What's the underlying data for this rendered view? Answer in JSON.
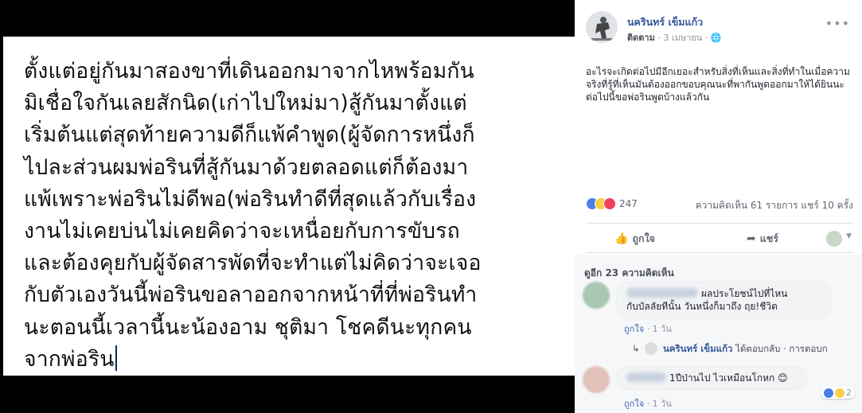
{
  "photo": {
    "lines": [
      "ตั้งแต่อยู่กันมาสองขาที่เดินออกมาจากไหพร้อมกัน",
      "มิเชื่อใจกันเลยสักนิด(เก่าไปใหม่มา)สู้กันมาตั้งแต่",
      "เริ่มต้นแต่สุดท้ายความดีก็แพ้คำพูด(ผู้จัดการหนึ่งก็",
      "ไปละส่วนผมพ่อรินที่สู้กันมาด้วยตลอดแต่ก็ต้องมา",
      "แพ้เพราะพ่อรินไม่ดีพอ(พ่อรินทำดีที่สุดแล้วกับเรื่อง",
      "งานไม่เคยบ่นไม่เคยคิดว่าจะเหนื่อยกับการขับรถ",
      "และต้องคุยกับผู้จัดสารพัดที่จะทำแต่ไม่คิดว่าจะเจอ",
      "กับตัวเองวันนี้พ่อรินขอลาออกจากหน้าที่ที่พ่อรินทำ",
      "นะตอนนี้เวลานี้นะน้องอาม ชุติมา  โชคดีนะทุกคน",
      "จากพ่อริน"
    ]
  },
  "post": {
    "author": "นครินทร์ เข็มแก้ว",
    "follow_label": "ติดตาม",
    "date": "3 เมษายน",
    "text": "อะไรจะเกิดต่อไปมีอีกเยอะสำหรับสิ่งที่เห็นและสิ่งที่ทำในเมื่อความจริงที่รู้ที่เห็นมันต้องออกขอบคุณนะที่พากันพูดออกมาให้ได้ยินนะต่อไปนี้ขอพ่อรินพูดบ้างแล้วกัน",
    "reaction_count": "247",
    "stats": "ความคิดเห็น 61 รายการ  แชร์ 10 ครั้ง",
    "like_label": "ถูกใจ",
    "share_label": "แชร์"
  },
  "comments": {
    "more_label": "ดูอีก 23 ความคิดเห็น",
    "items": [
      {
        "line1": "ผลประโยชน์ไปที่ไหน",
        "line2": "กับบัลลัยทีนั้น วันหนึ่งก็มาถึง ฤย!ชีวิต",
        "like": "ถูกใจ",
        "time": "1 วัน"
      },
      {
        "line1": "1ปีป่านไป ไวเหมือนโกหก",
        "like": "ถูกใจ",
        "time": "1 วัน",
        "react_count": "2"
      }
    ],
    "reply": {
      "name": "นครินทร์ เข็มแก้ว",
      "text": "ได้ตอบกลับ · การตอบก"
    }
  },
  "colors": {
    "link": "#365899",
    "meta": "#90949c"
  }
}
